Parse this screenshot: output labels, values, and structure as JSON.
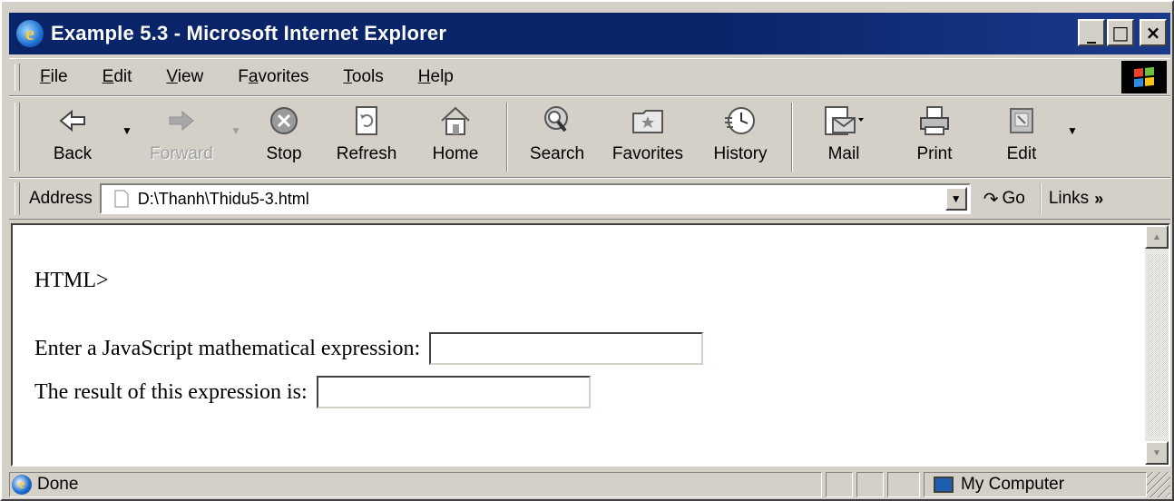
{
  "window": {
    "title": "Example 5.3 - Microsoft Internet Explorer",
    "controls": {
      "minimize": "_",
      "maximize": "□",
      "close": "×"
    }
  },
  "menu": {
    "items": [
      {
        "label": "File",
        "accel": "F",
        "rest": "ile"
      },
      {
        "label": "Edit",
        "accel": "E",
        "rest": "dit"
      },
      {
        "label": "View",
        "accel": "V",
        "rest": "iew"
      },
      {
        "label": "Favorites",
        "pre": "F",
        "accel": "a",
        "rest": "vorites"
      },
      {
        "label": "Tools",
        "accel": "T",
        "rest": "ools"
      },
      {
        "label": "Help",
        "accel": "H",
        "rest": "elp"
      }
    ]
  },
  "toolbar": {
    "back": "Back",
    "forward": "Forward",
    "stop": "Stop",
    "refresh": "Refresh",
    "home": "Home",
    "search": "Search",
    "favorites": "Favorites",
    "history": "History",
    "mail": "Mail",
    "print": "Print",
    "edit": "Edit"
  },
  "address": {
    "label": "Address",
    "value": "D:\\Thanh\\Thidu5-3.html",
    "go": "Go",
    "links": "Links"
  },
  "page": {
    "fragment": "HTML>",
    "expression_label": "Enter a JavaScript mathematical expression:",
    "expression_value": "",
    "result_label": "The result of this expression is:",
    "result_value": ""
  },
  "status": {
    "text": "Done",
    "zone": "My Computer"
  },
  "colors": {
    "titlebar": "#0a246a",
    "chrome": "#d4d0c8",
    "content_bg": "#ffffff"
  }
}
